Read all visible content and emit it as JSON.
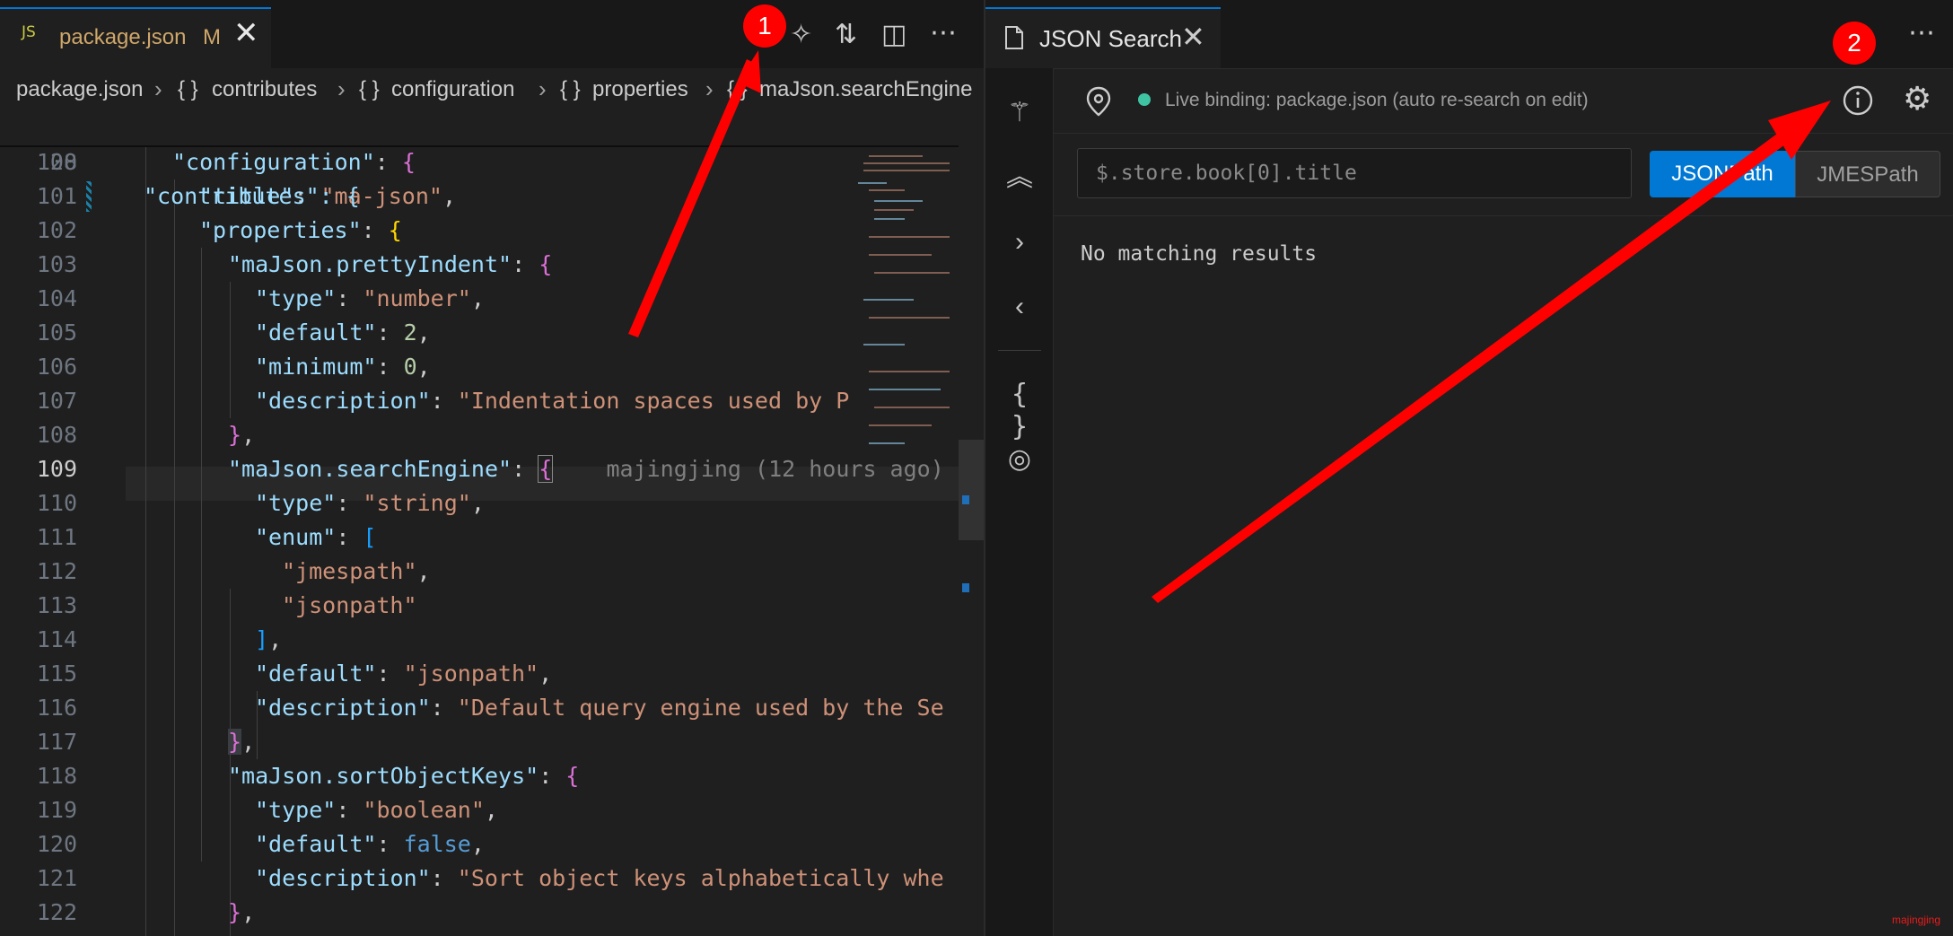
{
  "editor": {
    "tab": {
      "icon_text": "JS",
      "filename": "package.json",
      "status": "M"
    },
    "breadcrumb": [
      {
        "icon": "",
        "label": "package.json"
      },
      {
        "icon": "{ }",
        "label": "contributes"
      },
      {
        "icon": "{ }",
        "label": "configuration"
      },
      {
        "icon": "{ }",
        "label": "properties"
      },
      {
        "icon": "{ }",
        "label": "maJson.searchEngine"
      }
    ],
    "sticky_line": {
      "number": "28",
      "text": "\"contributes\": {"
    },
    "blame": "majingjing (12 hours ago)",
    "lines": [
      {
        "number": "100"
      },
      {
        "number": "101"
      },
      {
        "number": "102"
      },
      {
        "number": "103"
      },
      {
        "number": "104"
      },
      {
        "number": "105"
      },
      {
        "number": "106"
      },
      {
        "number": "107"
      },
      {
        "number": "108"
      },
      {
        "number": "109"
      },
      {
        "number": "110"
      },
      {
        "number": "111"
      },
      {
        "number": "112"
      },
      {
        "number": "113"
      },
      {
        "number": "114"
      },
      {
        "number": "115"
      },
      {
        "number": "116"
      },
      {
        "number": "117"
      },
      {
        "number": "118"
      },
      {
        "number": "119"
      },
      {
        "number": "120"
      },
      {
        "number": "121"
      },
      {
        "number": "122"
      }
    ],
    "code": {
      "configuration_key": "\"configuration\"",
      "title_key": "\"title\"",
      "title_val": "\"ma-json\"",
      "properties_key": "\"properties\"",
      "pretty_key": "\"maJson.prettyIndent\"",
      "type_key": "\"type\"",
      "number_val": "\"number\"",
      "default_key": "\"default\"",
      "two": "2",
      "minimum_key": "\"minimum\"",
      "zero": "0",
      "description_key": "\"description\"",
      "desc1": "\"Indentation spaces used by P",
      "search_key": "\"maJson.searchEngine\"",
      "string_val": "\"string\"",
      "enum_key": "\"enum\"",
      "jmespath_val": "\"jmespath\"",
      "jsonpath_item": "\"jsonpath\"",
      "jsonpath_default": "\"jsonpath\"",
      "desc2": "\"Default query engine used by the Se",
      "sort_key": "\"maJson.sortObjectKeys\"",
      "boolean_val": "\"boolean\"",
      "false_val": "false",
      "desc3": "\"Sort object keys alphabetically whe"
    }
  },
  "panel": {
    "tab_title": "JSON Search",
    "binding_text": "Live binding: package.json (auto re-search on edit)",
    "query_placeholder": "$.store.book[0].title",
    "query_value": "",
    "engines": [
      "JSONPath",
      "JMESPath"
    ],
    "selected_engine": "JSONPath",
    "result_text": "No matching results"
  },
  "annotations": {
    "badge1": "1",
    "badge2": "2",
    "arrow_color": "#ff0000",
    "watermark": "majingjing"
  },
  "colors": {
    "accent": "#0078d4",
    "live_dot": "#3fc4a3",
    "string": "#ce9178",
    "key": "#9cdcfe"
  }
}
